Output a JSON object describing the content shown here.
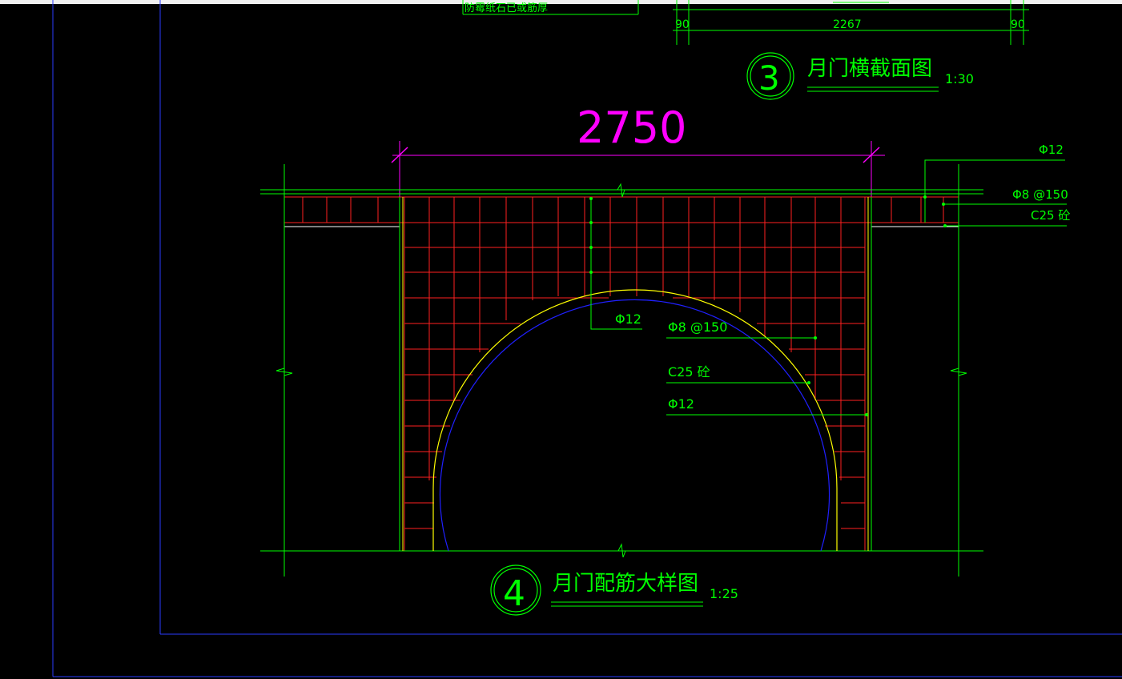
{
  "colors": {
    "background": "#000000",
    "frame": "#2a3cff",
    "green": "#00ff00",
    "red": "#ff2020",
    "magenta": "#ff00ff",
    "yellow": "#ffff00",
    "blue": "#2020ff",
    "white": "#ffffff"
  },
  "top_note": "防霉纸石已或筋厚",
  "section3": {
    "dims": [
      "90",
      "2267",
      "90"
    ],
    "circle_number": "3",
    "title": "月门横截面图",
    "scale": "1:30"
  },
  "section4": {
    "span_dimension": "2750",
    "circle_number": "4",
    "title": "月门配筋大样图",
    "scale": "1:25"
  },
  "callouts_right": [
    "Φ12",
    "Φ8 @150",
    "C25 砼"
  ],
  "callouts_inner": [
    "Φ12",
    "Φ8 @150",
    "C25 砼",
    "Φ12"
  ]
}
